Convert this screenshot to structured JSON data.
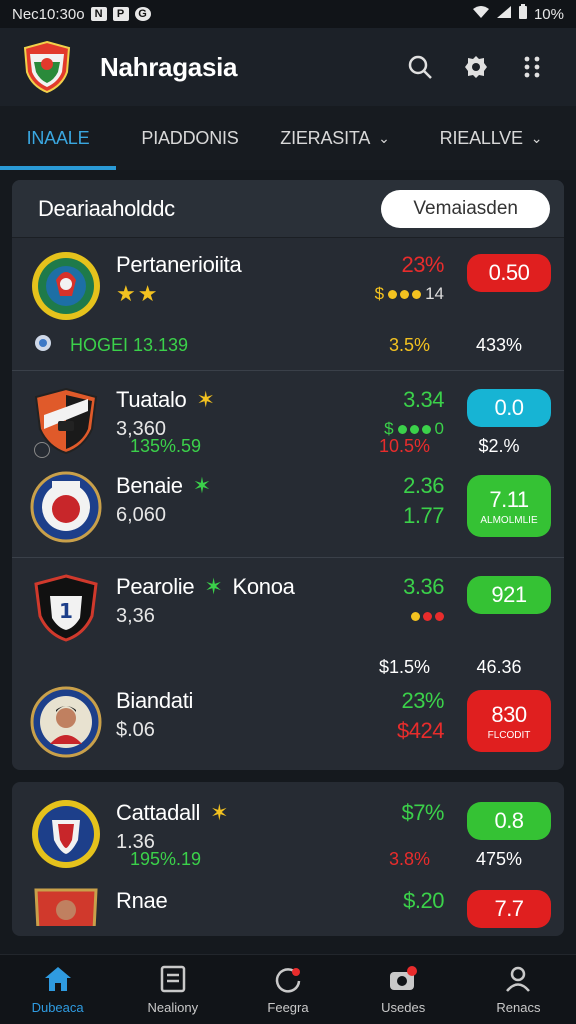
{
  "status": {
    "time": "Nec10:30o",
    "icon_a": "N",
    "icon_b": "P",
    "icon_c": "G",
    "right": "10%"
  },
  "app": {
    "title": "Nahragasia"
  },
  "tabs": [
    {
      "label": "INAALE",
      "active": true
    },
    {
      "label": "PIADDONIS"
    },
    {
      "label": "ZIERASITA"
    },
    {
      "label": "RIEALLVE"
    }
  ],
  "card1": {
    "title": "Deariaaholddc",
    "button": "Vemaiasden",
    "rows": [
      {
        "name": "Pertanerioiita",
        "stars": "★★",
        "sub_text": "",
        "stat_main": "23%",
        "stat_sub": "14",
        "badge": "0.50",
        "foot_left": "HOGEI 13.139",
        "foot_mid": "3.5%",
        "foot_right": "433%"
      },
      {
        "name": "Tuatalo",
        "stars": "✶",
        "sub_text": "3,360",
        "stat_main": "3.34",
        "stat_sub": "0",
        "badge": "0.0",
        "foot_left": "135%.59",
        "foot_mid": "10.5%",
        "foot_right": "$2.%"
      },
      {
        "name": "Benaie",
        "stars": "✶",
        "sub_text": "6,060",
        "stat_main": "2.36",
        "stat_sub": "1.77",
        "badge": "7.11",
        "badge_mini": "ALMOLMLIE"
      },
      {
        "name": "Pearolie",
        "stars": "✶",
        "name_extra": "Konoa",
        "sub_text": "3,36",
        "stat_main": "3.36",
        "stat_sub": "",
        "badge": "921",
        "foot_mid": "$1.5%",
        "foot_right": "46.36"
      },
      {
        "name": "Biandati",
        "stars": "",
        "sub_text": "$.06",
        "stat_main": "23%",
        "stat_sub": "$424",
        "badge": "830",
        "badge_mini": "FLCODIT"
      }
    ]
  },
  "card2": {
    "rows": [
      {
        "name": "Cattadall",
        "stars": "✶",
        "sub_text": "1.36",
        "stat_main": "$7%",
        "badge": "0.8",
        "foot_left": "195%.19",
        "foot_mid": "3.8%",
        "foot_right": "475%"
      },
      {
        "name": "Rnae",
        "stat_main": "$.20",
        "badge": "7.7"
      }
    ]
  },
  "nav": [
    {
      "label": "Dubeaca",
      "icon": "home-icon",
      "active": true
    },
    {
      "label": "Nealiony",
      "icon": "list-icon"
    },
    {
      "label": "Feegra",
      "icon": "refresh-icon"
    },
    {
      "label": "Usedes",
      "icon": "camera-icon"
    },
    {
      "label": "Renacs",
      "icon": "profile-icon"
    }
  ],
  "colors": {
    "accent": "#2a9ad6",
    "green": "#3bd14a",
    "red": "#e82c2c",
    "teal": "#17b4d4"
  }
}
